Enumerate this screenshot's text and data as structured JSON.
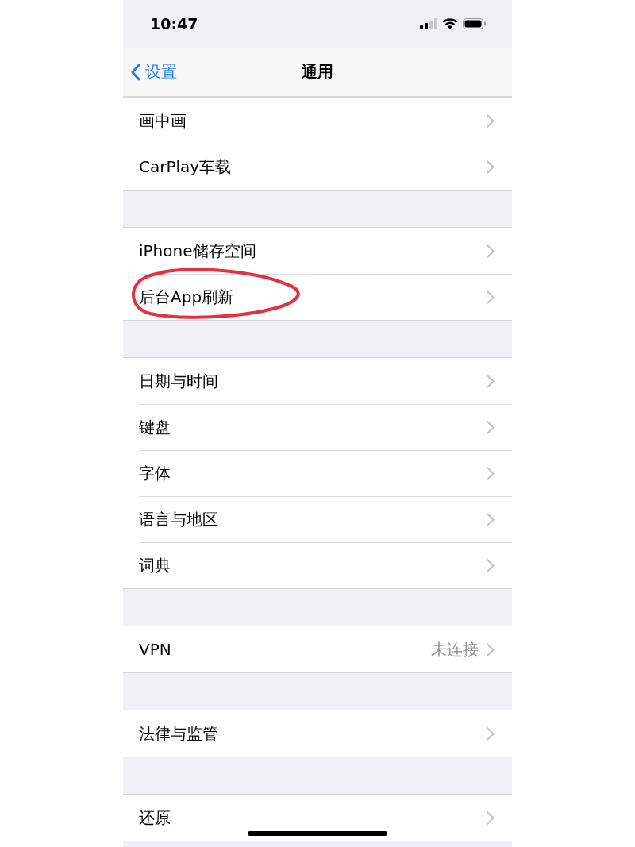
{
  "status_bar": {
    "time": "10:47"
  },
  "nav": {
    "back_label": "设置",
    "title": "通用"
  },
  "groups": [
    {
      "items": [
        {
          "label": "画中画"
        },
        {
          "label": "CarPlay车载"
        }
      ]
    },
    {
      "items": [
        {
          "label": "iPhone储存空间"
        },
        {
          "label": "后台App刷新",
          "annotated": true
        }
      ]
    },
    {
      "items": [
        {
          "label": "日期与时间"
        },
        {
          "label": "键盘"
        },
        {
          "label": "字体"
        },
        {
          "label": "语言与地区"
        },
        {
          "label": "词典"
        }
      ]
    },
    {
      "items": [
        {
          "label": "VPN",
          "detail": "未连接"
        }
      ]
    },
    {
      "items": [
        {
          "label": "法律与监管"
        }
      ]
    },
    {
      "items": [
        {
          "label": "还原"
        }
      ]
    }
  ]
}
